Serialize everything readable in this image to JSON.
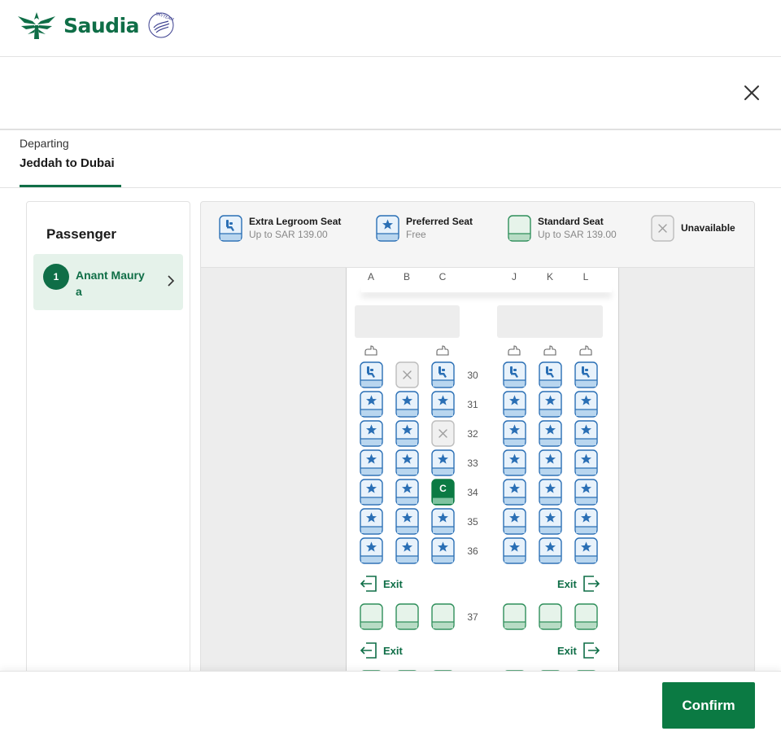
{
  "brand": {
    "name": "Saudia",
    "partner_logo": "SKYTEAM",
    "color": "#0f6e47"
  },
  "flight_tab": {
    "label": "Departing",
    "route": "Jeddah to Dubai"
  },
  "passenger_panel": {
    "title": "Passenger",
    "passengers": [
      {
        "number": "1",
        "name": "Anant Maurya"
      }
    ]
  },
  "legend": [
    {
      "name": "Extra Legroom Seat",
      "price": "Up to SAR 139.00",
      "icon": "extra-legroom-seat-icon"
    },
    {
      "name": "Preferred Seat",
      "price": "Free",
      "icon": "preferred-seat-icon"
    },
    {
      "name": "Standard Seat",
      "price": "Up to SAR 139.00",
      "icon": "standard-seat-icon"
    },
    {
      "name": "Unavailable",
      "price": "",
      "icon": "unavailable-seat-icon"
    }
  ],
  "seat_columns": [
    "A",
    "B",
    "C",
    "J",
    "K",
    "L"
  ],
  "seat_rows": [
    {
      "row": "30",
      "seats": [
        "legroom",
        "unavailable",
        "legroom",
        "legroom",
        "legroom",
        "legroom"
      ]
    },
    {
      "row": "31",
      "seats": [
        "preferred",
        "preferred",
        "preferred",
        "preferred",
        "preferred",
        "preferred"
      ]
    },
    {
      "row": "32",
      "seats": [
        "preferred",
        "preferred",
        "unavailable",
        "preferred",
        "preferred",
        "preferred"
      ]
    },
    {
      "row": "33",
      "seats": [
        "preferred",
        "preferred",
        "preferred",
        "preferred",
        "preferred",
        "preferred"
      ]
    },
    {
      "row": "34",
      "seats": [
        "preferred",
        "preferred",
        "selected",
        "preferred",
        "preferred",
        "preferred"
      ]
    },
    {
      "row": "35",
      "seats": [
        "preferred",
        "preferred",
        "preferred",
        "preferred",
        "preferred",
        "preferred"
      ]
    },
    {
      "row": "36",
      "seats": [
        "preferred",
        "preferred",
        "preferred",
        "preferred",
        "preferred",
        "preferred"
      ]
    },
    {
      "row": "37",
      "seats": [
        "standard",
        "standard",
        "standard",
        "standard",
        "standard",
        "standard"
      ]
    }
  ],
  "selected_seat_label": "C",
  "exit_label": "Exit",
  "footer": {
    "confirm_label": "Confirm"
  },
  "colors": {
    "primary_green": "#0b7a43",
    "seat_blue": "#2a6fb5",
    "seat_blue_fill": "#e8f2fb",
    "standard_green": "#2f8f5b",
    "standard_fill": "#e6f3ea",
    "unavailable_gray": "#bdbdbd"
  }
}
